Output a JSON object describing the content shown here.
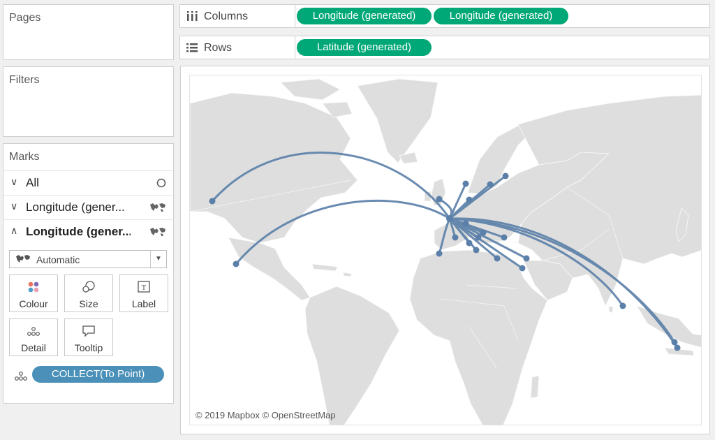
{
  "pages": {
    "title": "Pages"
  },
  "filters": {
    "title": "Filters"
  },
  "marks": {
    "title": "Marks",
    "rows": [
      {
        "label": "All",
        "icon": "circle-icon"
      },
      {
        "label": "Longitude (gener...",
        "icon": "map-icon"
      },
      {
        "label": "Longitude (gener...",
        "icon": "map-icon"
      }
    ],
    "mark_type": "Automatic",
    "buttons": {
      "colour": "Colour",
      "size": "Size",
      "label": "Label",
      "detail": "Detail",
      "tooltip": "Tooltip"
    },
    "detail_pill": "COLLECT(To Point)"
  },
  "columns": {
    "label": "Columns",
    "pills": [
      "Longitude (generated)",
      "Longitude (generated)"
    ]
  },
  "rows": {
    "label": "Rows",
    "pills": [
      "Latitude (generated)"
    ]
  },
  "map": {
    "credit": "© 2019 Mapbox © OpenStreetMap"
  },
  "colors": {
    "pill_green": "#00a777",
    "pill_blue": "#4a90b8",
    "flow_line": "#5a7fa8",
    "land": "#dedede"
  }
}
